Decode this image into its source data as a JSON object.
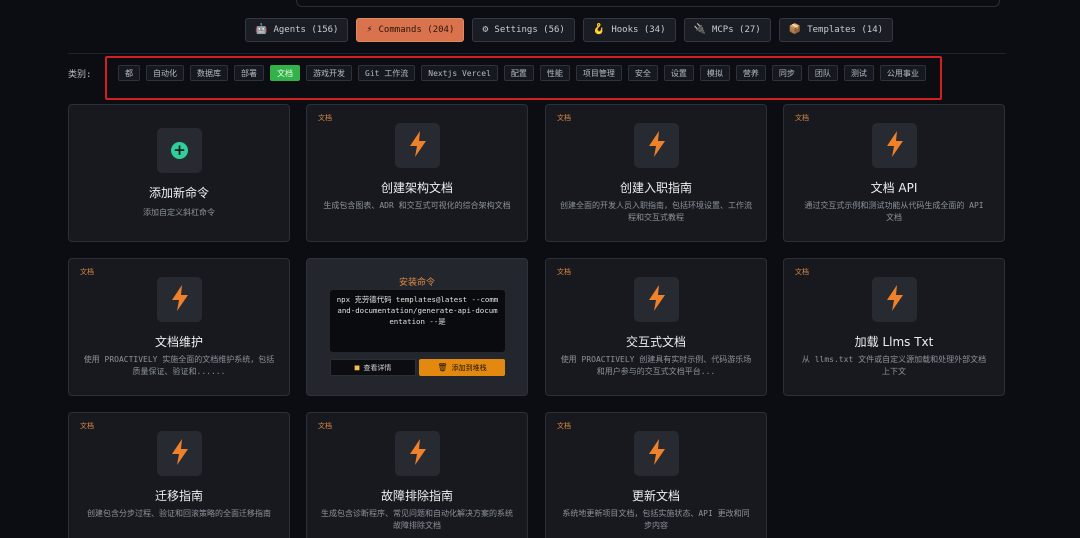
{
  "tabs": [
    {
      "icon": "robot-icon",
      "glyph": "🤖",
      "label": "Agents (156)",
      "active": false
    },
    {
      "icon": "bolt-icon",
      "glyph": "⚡",
      "label": "Commands (204)",
      "active": true
    },
    {
      "icon": "gear-icon",
      "glyph": "⚙",
      "label": "Settings (56)",
      "active": false
    },
    {
      "icon": "hook-icon",
      "glyph": "🪝",
      "label": "Hooks (34)",
      "active": false
    },
    {
      "icon": "plug-icon",
      "glyph": "🔌",
      "label": "MCPs (27)",
      "active": false
    },
    {
      "icon": "package-icon",
      "glyph": "📦",
      "label": "Templates (14)",
      "active": false
    }
  ],
  "categories": {
    "label": "类别:",
    "items": [
      "都",
      "自动化",
      "数据库",
      "部署",
      "文档",
      "游戏开发",
      "Git 工作流",
      "Nextjs Vercel",
      "配置",
      "性能",
      "项目管理",
      "安全",
      "设置",
      "模拟",
      "营养",
      "同步",
      "团队",
      "测试",
      "公用事业"
    ],
    "active": "文档"
  },
  "add_card": {
    "title": "添加新命令",
    "desc": "添加自定义斜杠命令"
  },
  "cards": [
    {
      "tag": "文档",
      "title": "创建架构文档",
      "desc": "生成包含图表、ADR 和交互式可视化的综合架构文档"
    },
    {
      "tag": "文档",
      "title": "创建入职指南",
      "desc": "创建全面的开发人员入职指南，包括环境设置、工作流程和交互式教程"
    },
    {
      "tag": "文档",
      "title": "文档 API",
      "desc": "通过交互式示例和测试功能从代码生成全面的 API 文档"
    },
    {
      "tag": "文档",
      "title": "文档维护",
      "desc": "使用 PROACTIVELY 实施全面的文档维护系统，包括质量保证、验证和......"
    },
    {
      "tag": "文档",
      "title": "交互式文档",
      "desc": "使用 PROACTIVELY 创建具有实时示例、代码游乐场和用户参与的交互式文档平台..."
    },
    {
      "tag": "文档",
      "title": "加载 Llms Txt",
      "desc": "从 llms.txt 文件或自定义源加载和处理外部文档上下文"
    },
    {
      "tag": "文档",
      "title": "迁移指南",
      "desc": "创建包含分步过程、验证和回滚策略的全面迁移指南"
    },
    {
      "tag": "文档",
      "title": "故障排除指南",
      "desc": "生成包含诊断程序、常见问题和自动化解决方案的系统故障排除文档"
    },
    {
      "tag": "文档",
      "title": "更新文档",
      "desc": "系统地更新项目文档，包括实施状态、API 更改和同步内容"
    }
  ],
  "install": {
    "title": "安装命令",
    "command": "npx 克劳德代码 templates@latest --command-documentation/generate-api-documentation --是",
    "details_label": "查看详情",
    "add_label": "添加到堆栈"
  },
  "colors": {
    "accent": "#d9734d",
    "active_chip": "#34b24a",
    "tag": "#df8a45",
    "highlight_box": "#d21f1f",
    "icon": "#f0812b"
  }
}
